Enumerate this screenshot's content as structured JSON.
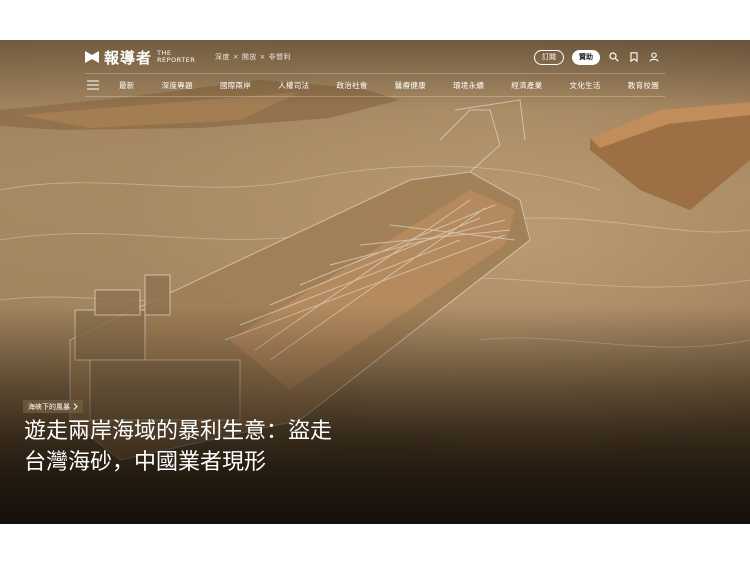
{
  "brand": {
    "name_zh": "報導者",
    "name_en_line1": "THE",
    "name_en_line2": "REPORTER",
    "tagline": "深度 × 開放 × 非營利"
  },
  "actions": {
    "subscribe": "訂閱",
    "donate": "贊助"
  },
  "icons": [
    "menu-icon",
    "search-icon",
    "bookmark-icon",
    "user-icon",
    "chevron-right-icon",
    "logo-icon"
  ],
  "nav": {
    "items": [
      "最新",
      "深度專題",
      "國際兩岸",
      "人權司法",
      "政治社會",
      "醫療健康",
      "環境永續",
      "經濟產業",
      "文化生活",
      "教育校園"
    ]
  },
  "article": {
    "kicker": "海峽下的風暴",
    "headline_line1": "遊走兩岸海域的暴利生意：盜走",
    "headline_line2": "台灣海砂，中國業者現形"
  },
  "colors": {
    "hero_sand": "#a5865f",
    "header_text": "#ffffff",
    "kicker_bg": "#705a3e"
  }
}
